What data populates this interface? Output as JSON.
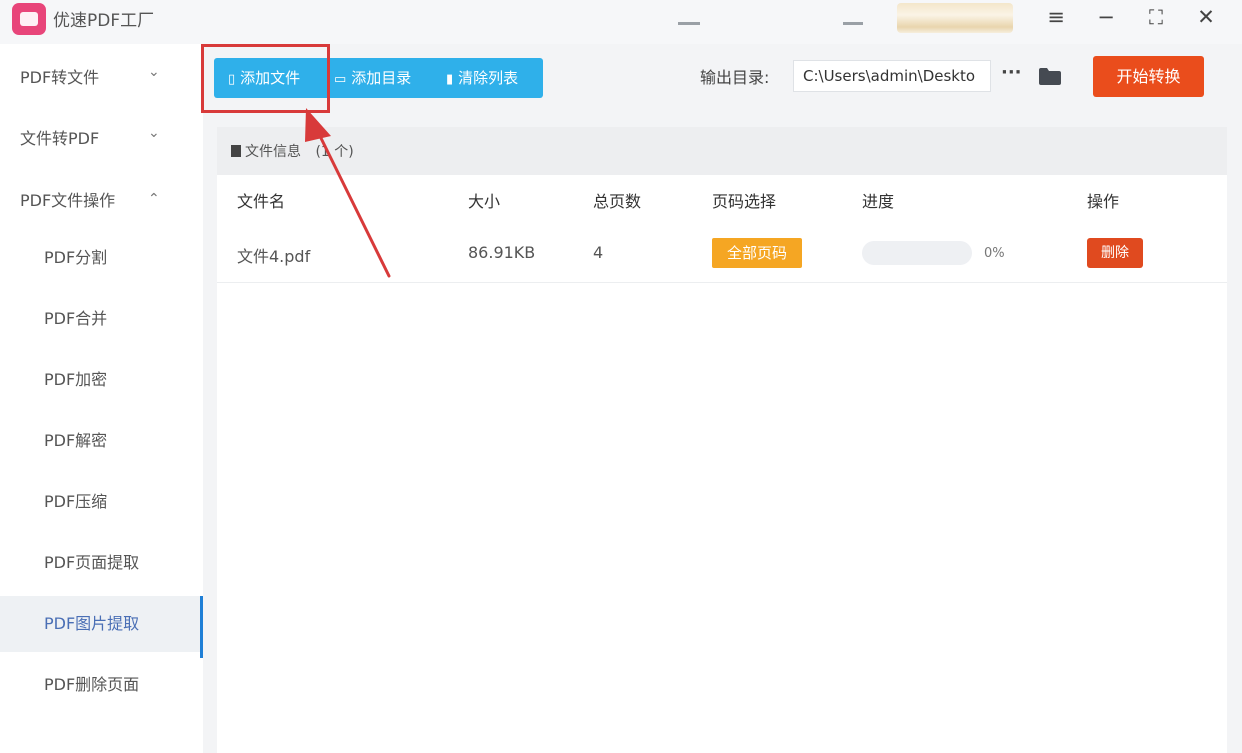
{
  "app": {
    "title": "优速PDF工厂"
  },
  "sidebar": {
    "categories": [
      {
        "label": "PDF转文件",
        "chevron": "⌄"
      },
      {
        "label": "文件转PDF",
        "chevron": "⌄"
      },
      {
        "label": "PDF文件操作",
        "chevron": "⌃"
      }
    ],
    "items": [
      {
        "label": "PDF分割"
      },
      {
        "label": "PDF合并"
      },
      {
        "label": "PDF加密"
      },
      {
        "label": "PDF解密"
      },
      {
        "label": "PDF压缩"
      },
      {
        "label": "PDF页面提取"
      },
      {
        "label": "PDF图片提取",
        "active": true
      },
      {
        "label": "PDF删除页面"
      }
    ]
  },
  "toolbar": {
    "add_file": "添加文件",
    "add_folder": "添加目录",
    "clear_list": "清除列表"
  },
  "output": {
    "label": "输出目录:",
    "path": "C:\\Users\\admin\\Deskto",
    "more": "···"
  },
  "start_button": "开始转换",
  "file_list": {
    "info_label": "文件信息",
    "count_text": "(1 个)",
    "columns": [
      "文件名",
      "大小",
      "总页数",
      "页码选择",
      "进度",
      "操作"
    ],
    "rows": [
      {
        "name": "文件4.pdf",
        "size": "86.91KB",
        "pages": "4",
        "page_select": "全部页码",
        "progress": 0,
        "progress_text": "0%",
        "action": "删除"
      }
    ]
  },
  "colors": {
    "toolbar": "#2fb0ea",
    "start": "#ea4d1c",
    "page_select": "#f5a623",
    "delete": "#e04a1f",
    "highlight": "#d83a3a"
  }
}
